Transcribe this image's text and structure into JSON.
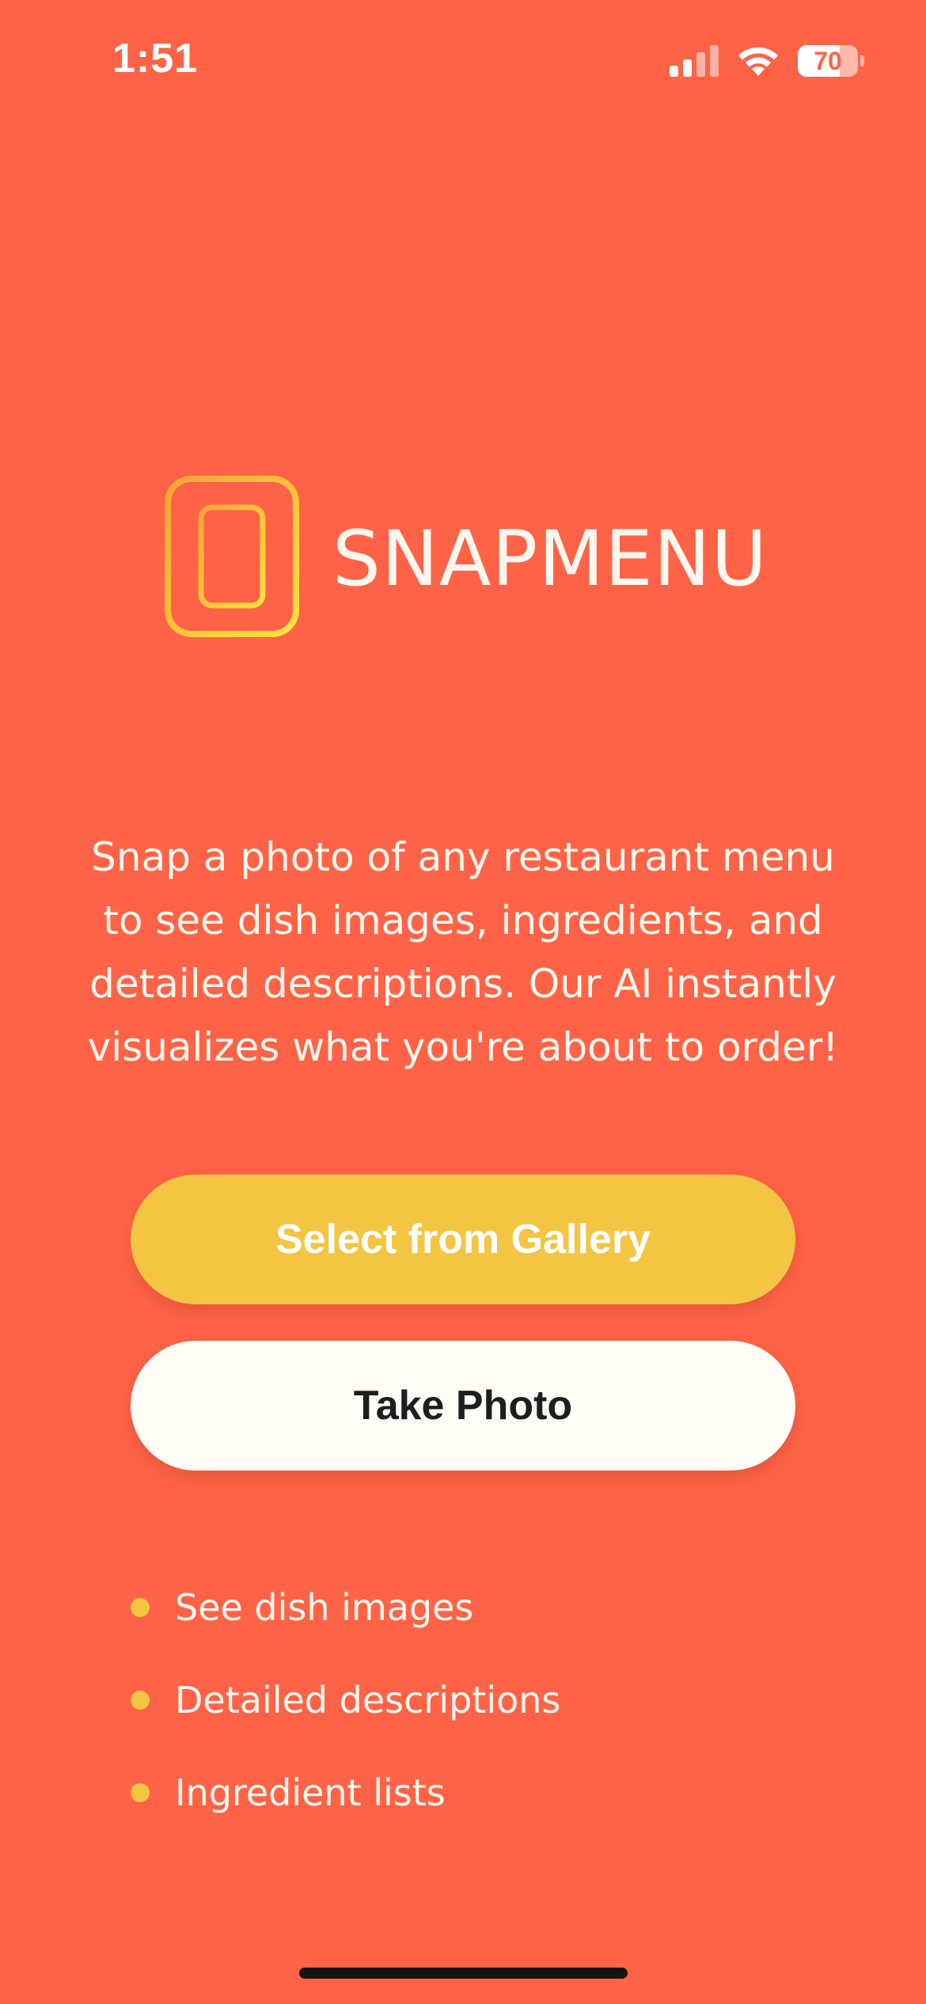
{
  "status_bar": {
    "time": "1:51",
    "battery_level": "70",
    "battery_fraction": 0.7,
    "icons": [
      "cellular-signal-icon",
      "wifi-icon",
      "battery-icon"
    ]
  },
  "brand": {
    "name": "SNAPMENU",
    "icon": "smartphone-icon"
  },
  "intro": {
    "lines": [
      "Snap a photo of any restaurant menu",
      "to see dish images, ingredients, and",
      "detailed descriptions. Our AI instantly",
      "visualizes what you're about to order!"
    ]
  },
  "actions": {
    "gallery_label": "Select from Gallery",
    "photo_label": "Take Photo"
  },
  "features": [
    {
      "label": "See dish images"
    },
    {
      "label": "Detailed descriptions"
    },
    {
      "label": "Ingredient lists"
    }
  ],
  "colors": {
    "background": "#FF6347",
    "accent_yellow": "#F4C542",
    "button_light": "#FFFDF6",
    "text_light": "#FFF7EE"
  }
}
